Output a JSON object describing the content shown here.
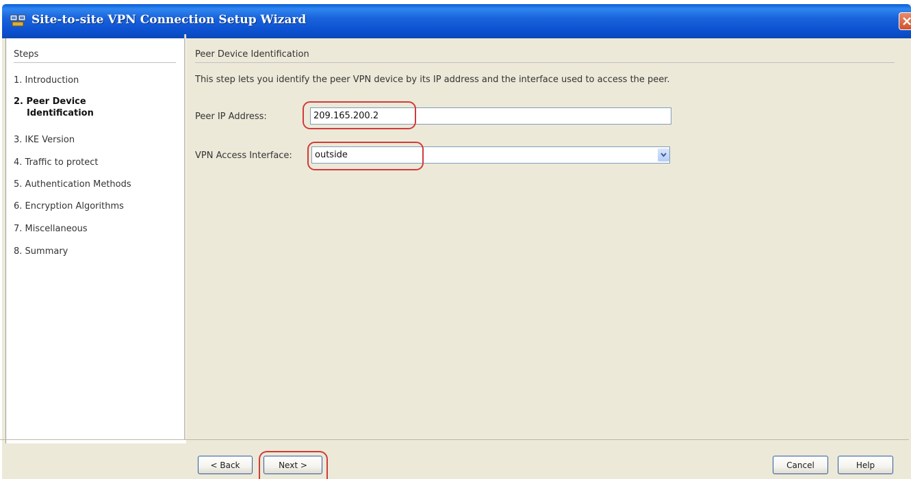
{
  "window": {
    "title": "Site-to-site VPN Connection Setup Wizard"
  },
  "icons": {
    "app": "vpn-wizard-icon",
    "close": "close-icon",
    "dropdown": "chevron-down-icon"
  },
  "colors": {
    "titlebar": "#1a64dc",
    "background": "#ece9d8",
    "highlight": "#d03a3a",
    "close": "#d2512c"
  },
  "steps": {
    "heading": "Steps",
    "items": [
      {
        "number": "1.",
        "label": "Introduction",
        "current": false
      },
      {
        "number": "2.",
        "label": "Peer Device",
        "label2": "Identification",
        "current": true
      },
      {
        "number": "3.",
        "label": "IKE Version",
        "current": false
      },
      {
        "number": "4.",
        "label": "Traffic to protect",
        "current": false
      },
      {
        "number": "5.",
        "label": "Authentication Methods",
        "current": false
      },
      {
        "number": "6.",
        "label": "Encryption Algorithms",
        "current": false
      },
      {
        "number": "7.",
        "label": "Miscellaneous",
        "current": false
      },
      {
        "number": "8.",
        "label": "Summary",
        "current": false
      }
    ]
  },
  "content": {
    "heading": "Peer Device Identification",
    "description": "This step lets you identify the peer VPN device by its IP address and the interface used to access the peer.",
    "peer_ip": {
      "label": "Peer IP Address:",
      "value": "209.165.200.2"
    },
    "vpn_interface": {
      "label": "VPN Access Interface:",
      "value": "outside"
    }
  },
  "buttons": {
    "back": "< Back",
    "next": "Next >",
    "cancel": "Cancel",
    "help": "Help"
  }
}
